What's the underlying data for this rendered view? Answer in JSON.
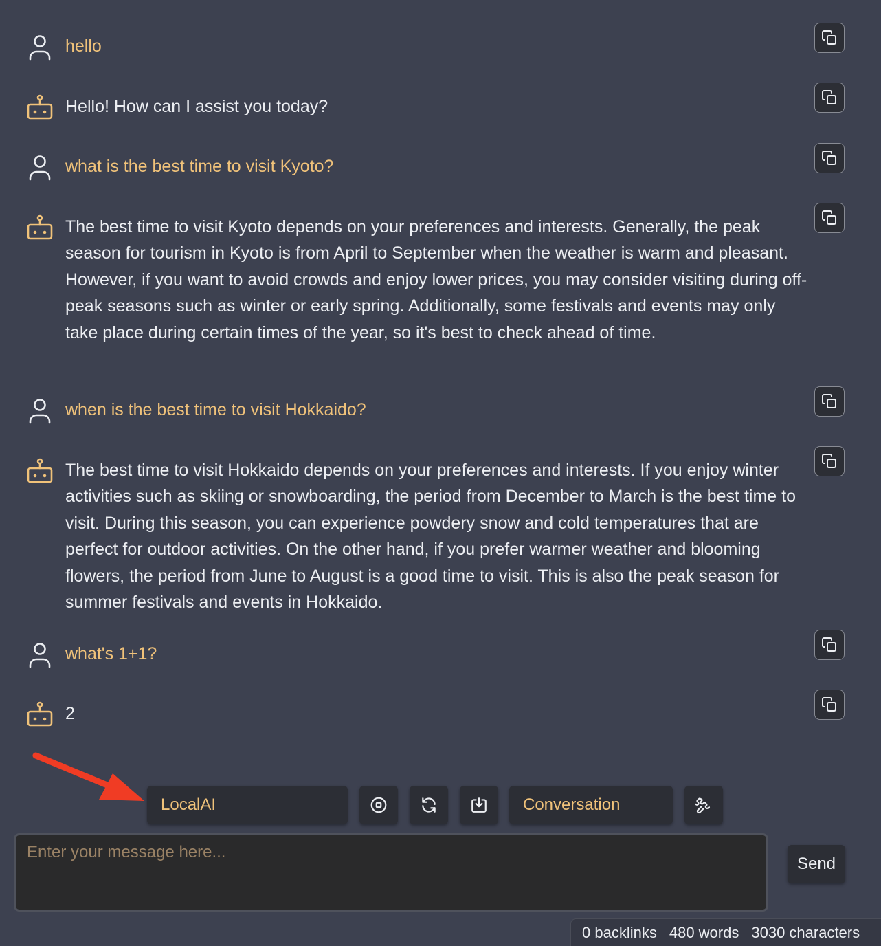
{
  "messages": [
    {
      "role": "user",
      "text": "hello"
    },
    {
      "role": "assistant",
      "text": "Hello! How can I assist you today?"
    },
    {
      "role": "user",
      "text": "what is the best time to visit Kyoto?"
    },
    {
      "role": "assistant",
      "text": "The best time to visit Kyoto depends on your preferences and interests. Generally, the peak season for tourism in Kyoto is from April to September when the weather is warm and pleasant. However, if you want to avoid crowds and enjoy lower prices, you may consider visiting during off-peak seasons such as winter or early spring. Additionally, some festivals and events may only take place during certain times of the year, so it's best to check ahead of time."
    },
    {
      "role": "user",
      "text": "when is the best time to visit Hokkaido?"
    },
    {
      "role": "assistant",
      "text": "The best time to visit Hokkaido depends on your preferences and interests. If you enjoy winter activities such as skiing or snowboarding, the period from December to March is the best time to visit. During this season, you can experience powdery snow and cold temperatures that are perfect for outdoor activities. On the other hand, if you prefer warmer weather and blooming flowers, the period from June to August is a good time to visit. This is also the peak season for summer festivals and events in Hokkaido."
    },
    {
      "role": "user",
      "text": "what's 1+1?"
    },
    {
      "role": "assistant",
      "text": "2"
    }
  ],
  "toolbar": {
    "provider_label": "LocalAI",
    "mode_label": "Conversation",
    "icons": [
      "stop-icon",
      "refresh-icon",
      "download-icon",
      "puzzle-icon"
    ]
  },
  "composer": {
    "placeholder": "Enter your message here...",
    "send_label": "Send"
  },
  "status": {
    "backlinks": "0 backlinks",
    "words": "480 words",
    "characters": "3030 characters"
  },
  "colors": {
    "background": "#3d4150",
    "user_text": "#f0c27a",
    "assistant_text": "#eceef2",
    "arrow": "#f03c24"
  }
}
